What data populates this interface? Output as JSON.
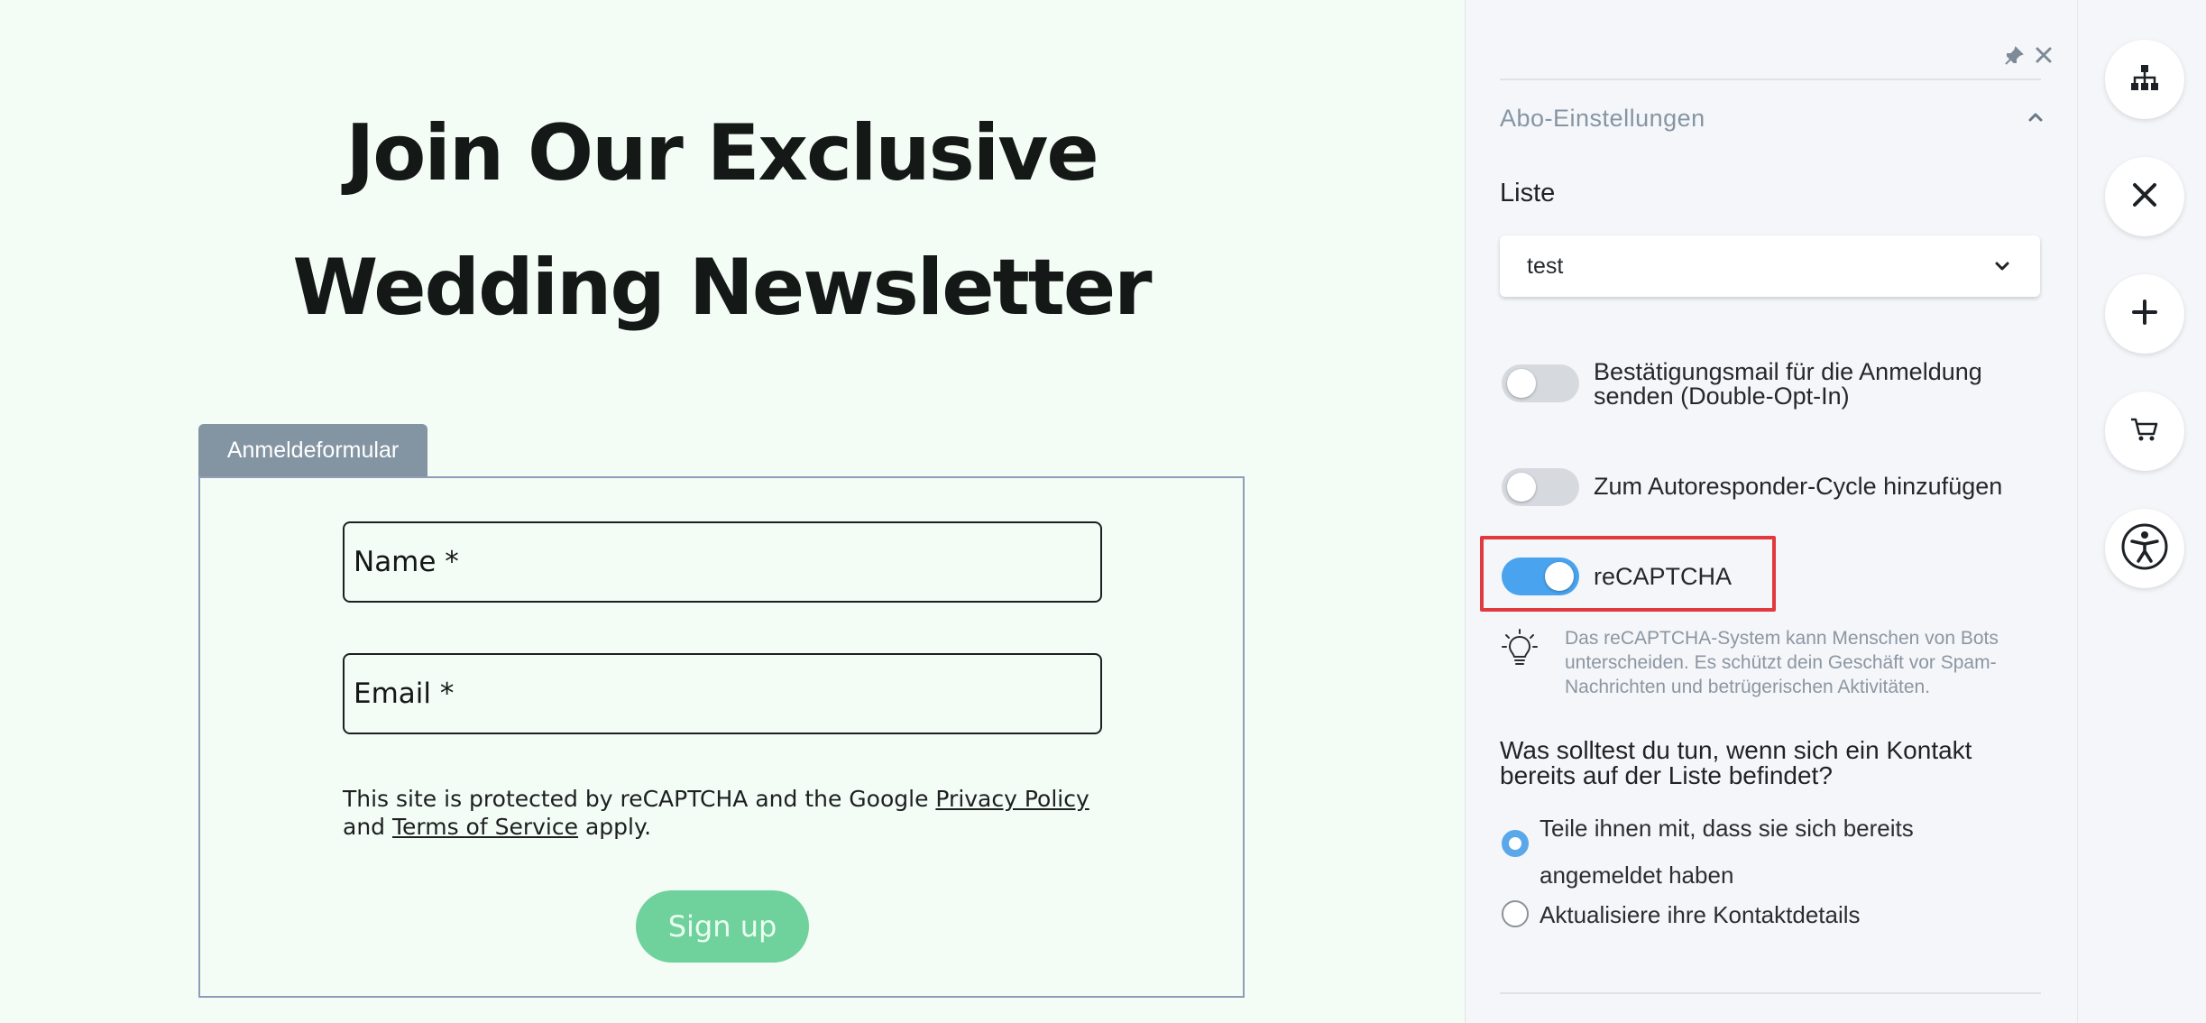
{
  "page": {
    "headline_line1": "Join Our Exclusive",
    "headline_line2": "Wedding Newsletter",
    "form_tab": "Anmeldeformular",
    "name_placeholder": "Name *",
    "email_placeholder": "Email *",
    "notice_pre": "This site is protected by reCAPTCHA and the Google ",
    "privacy_link": "Privacy Policy",
    "notice_and": "and ",
    "terms_link": "Terms of Service",
    "notice_post": " apply.",
    "signup_button": "Sign up"
  },
  "panel": {
    "section_title": "Abo-Einstellungen",
    "list_label": "Liste",
    "list_value": "test",
    "toggles": [
      {
        "label": "Bestätigungsmail für die Anmeldung senden (Double-Opt-In)",
        "on": false
      },
      {
        "label": "Zum Autoresponder-Cycle hinzufügen",
        "on": false
      },
      {
        "label": "reCAPTCHA",
        "on": true
      }
    ],
    "hint": "Das reCAPTCHA-System kann Menschen von Bots unterscheiden. Es schützt dein Geschäft vor Spam-Nachrichten und betrügerischen Aktivitäten.",
    "question": "Was solltest du tun, wenn sich ein Kontakt bereits auf der Liste befindet?",
    "options": [
      {
        "label": "Teile ihnen mit, dass sie sich bereits angemeldet haben",
        "selected": true
      },
      {
        "label": "Aktualisiere ihre Kontaktdetails",
        "selected": false
      }
    ]
  },
  "rail": {
    "icons": [
      "sitemap-icon",
      "tools-icon",
      "plus-icon",
      "cart-icon",
      "accessibility-icon"
    ]
  },
  "colors": {
    "canvas_bg": "#f3fcf5",
    "tab_bg": "#8394a3",
    "signup_bg": "#6fd19b",
    "toggle_on": "#4aa3ee",
    "highlight": "#e2393f"
  }
}
